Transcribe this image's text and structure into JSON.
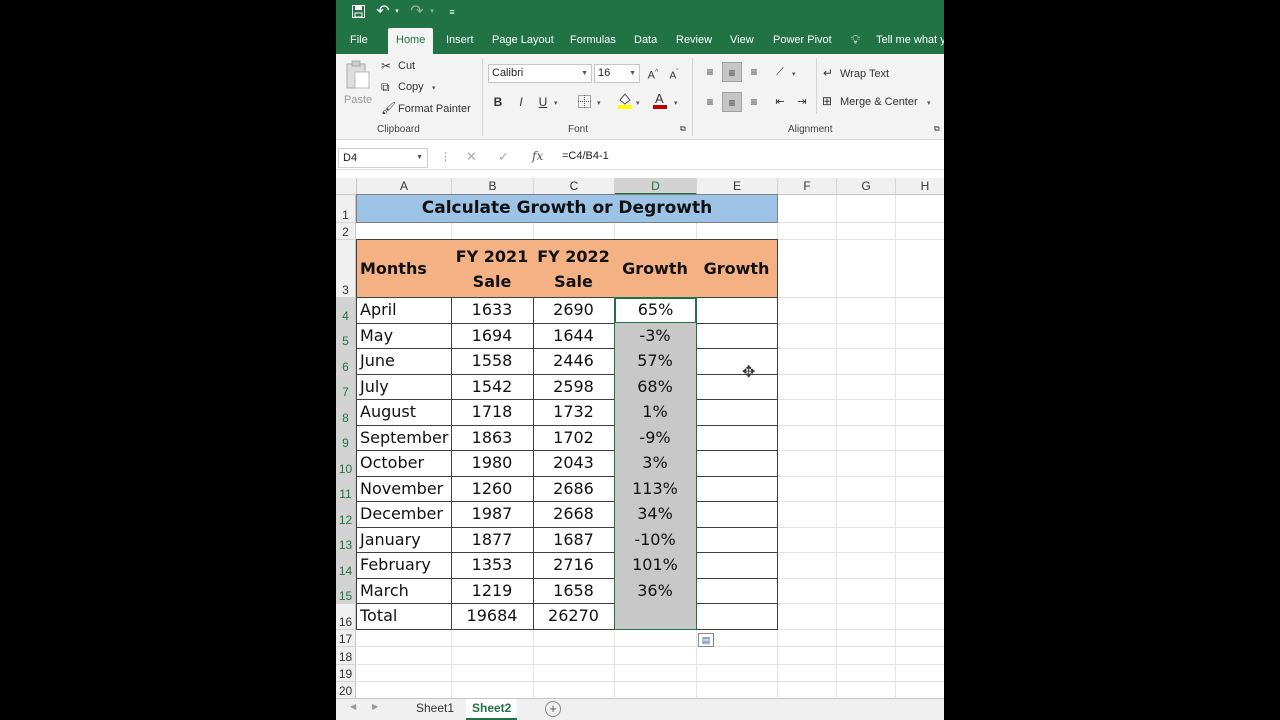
{
  "quick_access": {
    "save_icon": "save-icon",
    "undo_icon": "undo-icon",
    "redo_icon": "redo-icon",
    "customize_icon": "customize-icon"
  },
  "tabs": [
    "File",
    "Home",
    "Insert",
    "Page Layout",
    "Formulas",
    "Data",
    "Review",
    "View",
    "Power Pivot"
  ],
  "tell_me": "Tell me what y",
  "clipboard": {
    "paste": "Paste",
    "cut": "Cut",
    "copy": "Copy",
    "format_painter": "Format Painter",
    "group": "Clipboard"
  },
  "font": {
    "name": "Calibri",
    "size": "16",
    "group": "Font",
    "bold": "B",
    "italic": "I",
    "underline": "U"
  },
  "alignment": {
    "wrap_text": "Wrap Text",
    "merge_center": "Merge & Center",
    "group": "Alignment"
  },
  "formula_bar": {
    "name_box": "D4",
    "formula": "=C4/B4-1"
  },
  "columns": [
    "A",
    "B",
    "C",
    "D",
    "E",
    "F",
    "G",
    "H"
  ],
  "rows": [
    "1",
    "2",
    "3",
    "4",
    "5",
    "6",
    "7",
    "8",
    "9",
    "10",
    "11",
    "12",
    "13",
    "14",
    "15",
    "16",
    "17",
    "18",
    "19",
    "20"
  ],
  "title": "Calculate Growth or Degrowth",
  "headers": {
    "months": "Months",
    "fy2021_line1": "FY 2021",
    "fy2021_line2": "Sale",
    "fy2022_line1": "FY 2022",
    "fy2022_line2": "Sale",
    "growth": "Growth",
    "growth2": "Growth"
  },
  "table": [
    {
      "month": "April",
      "fy2021": "1633",
      "fy2022": "2690",
      "growth": "65%"
    },
    {
      "month": "May",
      "fy2021": "1694",
      "fy2022": "1644",
      "growth": "-3%"
    },
    {
      "month": "June",
      "fy2021": "1558",
      "fy2022": "2446",
      "growth": "57%"
    },
    {
      "month": "July",
      "fy2021": "1542",
      "fy2022": "2598",
      "growth": "68%"
    },
    {
      "month": "August",
      "fy2021": "1718",
      "fy2022": "1732",
      "growth": "1%"
    },
    {
      "month": "September",
      "fy2021": "1863",
      "fy2022": "1702",
      "growth": "-9%"
    },
    {
      "month": "October",
      "fy2021": "1980",
      "fy2022": "2043",
      "growth": "3%"
    },
    {
      "month": "November",
      "fy2021": "1260",
      "fy2022": "2686",
      "growth": "113%"
    },
    {
      "month": "December",
      "fy2021": "1987",
      "fy2022": "2668",
      "growth": "34%"
    },
    {
      "month": "January",
      "fy2021": "1877",
      "fy2022": "1687",
      "growth": "-10%"
    },
    {
      "month": "February",
      "fy2021": "1353",
      "fy2022": "2716",
      "growth": "101%"
    },
    {
      "month": "March",
      "fy2021": "1219",
      "fy2022": "1658",
      "growth": "36%"
    }
  ],
  "total": {
    "label": "Total",
    "fy2021": "19684",
    "fy2022": "26270"
  },
  "sheets": {
    "sheet1": "Sheet1",
    "sheet2": "Sheet2",
    "add": "+"
  },
  "colors": {
    "excel_green": "#217346",
    "title_fill": "#9dc3e6",
    "header_fill": "#f4b183",
    "selection_fill": "#c8c8c8"
  }
}
